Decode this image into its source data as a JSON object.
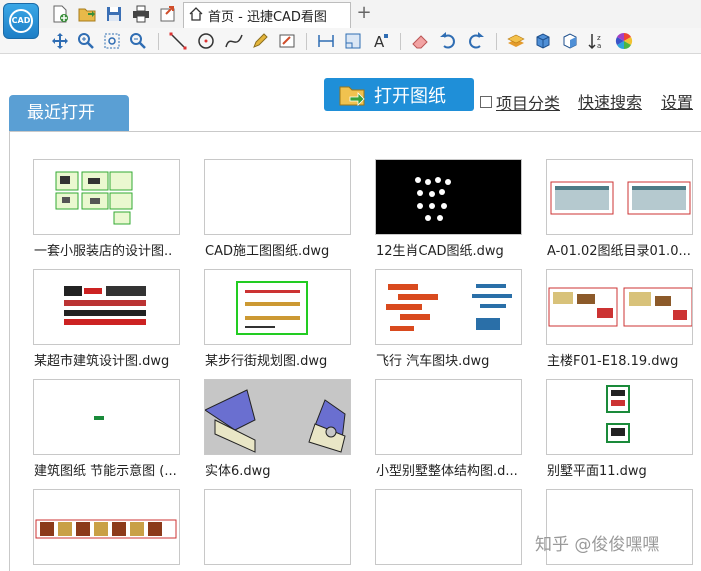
{
  "window": {
    "tab_title": "首页 - 迅捷CAD看图",
    "logo_text": "CAD"
  },
  "quick_access": [
    {
      "icon": "new-file-icon",
      "color": "#3a8f3a"
    },
    {
      "icon": "open-folder-icon",
      "color": "#d6a334"
    },
    {
      "icon": "save-icon",
      "color": "#3a6fb5"
    },
    {
      "icon": "print-icon",
      "color": "#444444"
    },
    {
      "icon": "export-icon",
      "color": "#d04d2a"
    }
  ],
  "toolbar": {
    "icons": [
      "pan-icon",
      "zoom-window-icon",
      "zoom-extents-icon",
      "zoom-realtime-icon",
      "line-icon",
      "circle-icon",
      "curve-icon",
      "pen-icon",
      "annotate-icon",
      "measure-distance-icon",
      "measure-area-icon",
      "text-icon",
      "eraser-icon",
      "undo-icon",
      "redo-icon",
      "layers-icon",
      "3d-box-icon",
      "3d-cube-icon",
      "sort-icon",
      "color-wheel-icon"
    ]
  },
  "actions": {
    "open_drawing_label": "打开图纸",
    "category_label": "项目分类",
    "category_checked": false,
    "quick_search_label": "快速搜索",
    "settings_label": "设置"
  },
  "recent": {
    "tab_label": "最近打开",
    "files": [
      {
        "name": "一套小服装店的设计图..",
        "preview": "green-plan"
      },
      {
        "name": "CAD施工图图纸.dwg",
        "preview": "blank"
      },
      {
        "name": "12生肖CAD图纸.dwg",
        "preview": "black-zodiac"
      },
      {
        "name": "A-01.02图纸目录01.0...",
        "preview": "elevations"
      },
      {
        "name": "某超市建筑设计图.dwg",
        "preview": "supermarket"
      },
      {
        "name": "某步行街规划图.dwg",
        "preview": "street-plan"
      },
      {
        "name": "飞行 汽车图块.dwg",
        "preview": "vehicles"
      },
      {
        "name": "主楼F01-E18.19.dwg",
        "preview": "main-building"
      },
      {
        "name": "建筑图纸 节能示意图 (...",
        "preview": "tiny-dot"
      },
      {
        "name": "实体6.dwg",
        "preview": "solid-3d"
      },
      {
        "name": "小型别墅整体结构图.d...",
        "preview": "blank"
      },
      {
        "name": "别墅平面11.dwg",
        "preview": "villa"
      },
      {
        "name": "",
        "preview": "strip"
      },
      {
        "name": "",
        "preview": "blank"
      },
      {
        "name": "",
        "preview": "blank"
      },
      {
        "name": "",
        "preview": "blank"
      }
    ]
  },
  "watermark": "知乎 @俊俊嘿嘿"
}
